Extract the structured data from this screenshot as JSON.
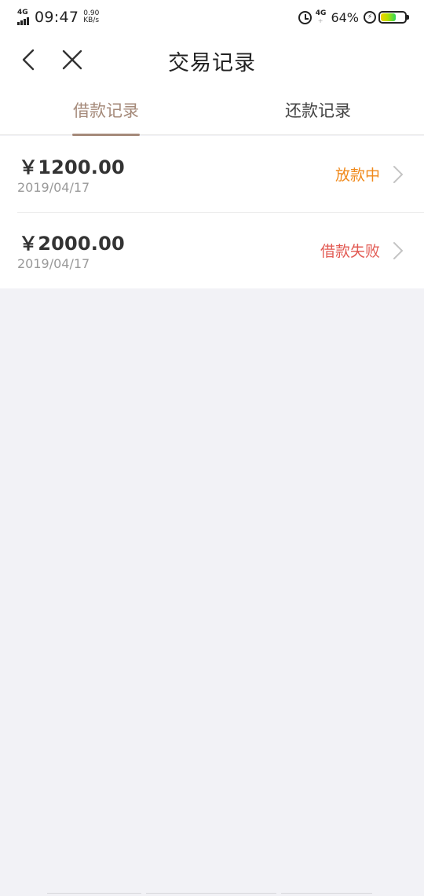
{
  "status_bar": {
    "network_left": "4G",
    "time": "09:47",
    "speed_value": "0.90",
    "speed_unit": "KB/s",
    "network_right": "4G",
    "network_right_sub": "+",
    "battery_pct": "64%",
    "battery_level": 0.64,
    "icons": [
      "signal-icon",
      "alarm-icon",
      "charging-icon",
      "battery-icon"
    ]
  },
  "nav": {
    "title": "交易记录",
    "back_icon": "chevron-left-icon",
    "close_icon": "close-icon"
  },
  "tabs": [
    {
      "label": "借款记录",
      "active": true
    },
    {
      "label": "还款记录",
      "active": false
    }
  ],
  "records": [
    {
      "amount": "￥1200.00",
      "date": "2019/04/17",
      "status": "放款中",
      "status_color": "#f08a1c"
    },
    {
      "amount": "￥2000.00",
      "date": "2019/04/17",
      "status": "借款失败",
      "status_color": "#e25b54"
    }
  ],
  "colors": {
    "accent": "#a58a7a",
    "background": "#f2f2f6"
  }
}
